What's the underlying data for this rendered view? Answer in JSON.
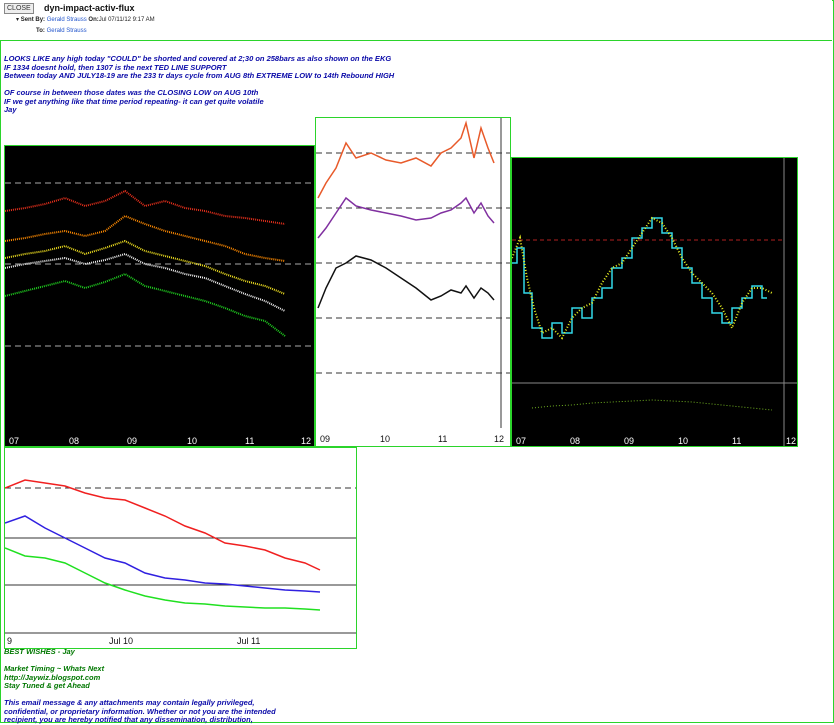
{
  "header": {
    "close_label": "CLOSE",
    "subject": "dyn-impact-activ-flux",
    "sent_by_label": "Sent By:",
    "sender": "Gerald Strauss",
    "on_label": "On:",
    "date": "Jul 07/11/12 9:17 AM",
    "to_label": "To:",
    "recipient": "Gerald Strauss"
  },
  "body": {
    "line1": "LOOKS LIKE any high today \"COULD\" be shorted and covered at 2;30 on 258bars as also shown on the EKG",
    "line2": "IF 1334 doesnt hold, then 1307 is the next TED LINE SUPPORT",
    "line3": "Between today AND JULY18-19 are the 233 tr days cycle from AUG 8th EXTREME LOW to 14th Rebound HIGH",
    "line4": "OF course in between those dates was the CLOSING LOW on AUG 10th",
    "line5": "IF we get anything like that time period repeating- it can get quite volatile",
    "line6": "Jay"
  },
  "charts": {
    "left_axis": [
      "07",
      "08",
      "09",
      "10",
      "11",
      "12"
    ],
    "middle_axis": [
      "09",
      "10",
      "11",
      "12"
    ],
    "right_axis": [
      "07",
      "08",
      "09",
      "10",
      "11",
      "12"
    ],
    "bottom_axis": [
      "9",
      "Jul 10",
      "Jul 11"
    ]
  },
  "footer": {
    "wishes": "BEST WISHES - Jay",
    "line1": "Market Timing ~ Whats Next",
    "line2": "http://Jaywiz.blogspot.com",
    "line3": "Stay Tuned & get Ahead",
    "disclaimer1": "This email message & any attachments may contain legally privileged,",
    "disclaimer2": "confidential, or proprietary information. Whether or not you are the intended",
    "disclaimer3": "recipient, you are hereby notified that any dissemination, distribution,"
  }
}
